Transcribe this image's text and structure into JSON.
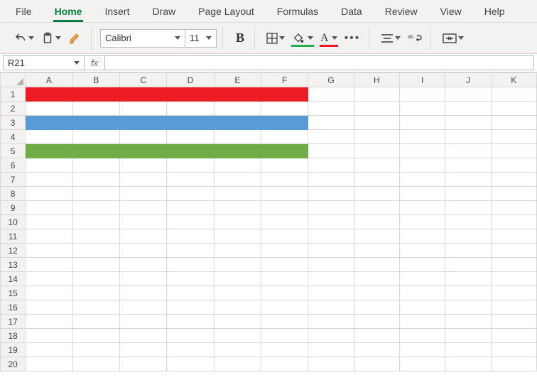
{
  "menu": {
    "items": [
      "File",
      "Home",
      "Insert",
      "Draw",
      "Page Layout",
      "Formulas",
      "Data",
      "Review",
      "View",
      "Help"
    ],
    "active_index": 1
  },
  "toolbar": {
    "font_name": "Calibri",
    "font_size": "11"
  },
  "namebox": {
    "value": "R21"
  },
  "formula": {
    "value": ""
  },
  "fx_label": "fx",
  "columns": [
    "A",
    "B",
    "C",
    "D",
    "E",
    "F",
    "G",
    "H",
    "I",
    "J",
    "K"
  ],
  "visible_rows": 20,
  "fills": {
    "1": {
      "range": "A:F",
      "color": "#ed1c24"
    },
    "3": {
      "range": "A:F",
      "color": "#5b9bd5"
    },
    "5": {
      "range": "A:F",
      "color": "#70ad47"
    }
  }
}
